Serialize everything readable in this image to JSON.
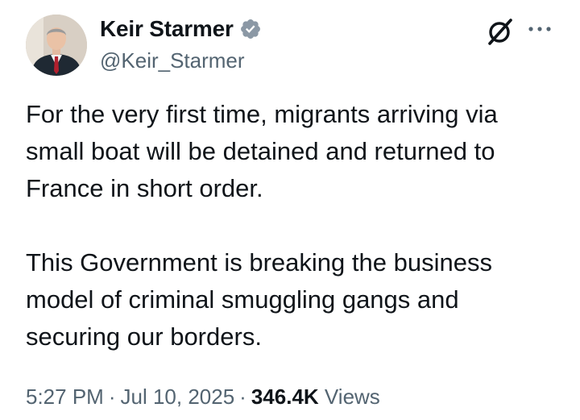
{
  "author": {
    "name": "Keir Starmer",
    "handle": "@Keir_Starmer",
    "verified_icon": "verified-badge-icon",
    "verified_color": "#1d9bf0"
  },
  "header_actions": {
    "grok_icon": "grok-icon",
    "more_icon": "more-options-icon"
  },
  "tweet": {
    "paragraphs": [
      "For the very first time, migrants arriving via small boat will be detained and returned to France in short order.",
      "This Government is breaking the business model of criminal smuggling gangs and securing our borders."
    ]
  },
  "meta": {
    "time": "5:27 PM",
    "separator": "·",
    "date": "Jul 10, 2025",
    "views_count": "346.4K",
    "views_label": "Views"
  },
  "colors": {
    "text_primary": "#0f1419",
    "text_secondary": "#536471",
    "background": "#ffffff"
  }
}
